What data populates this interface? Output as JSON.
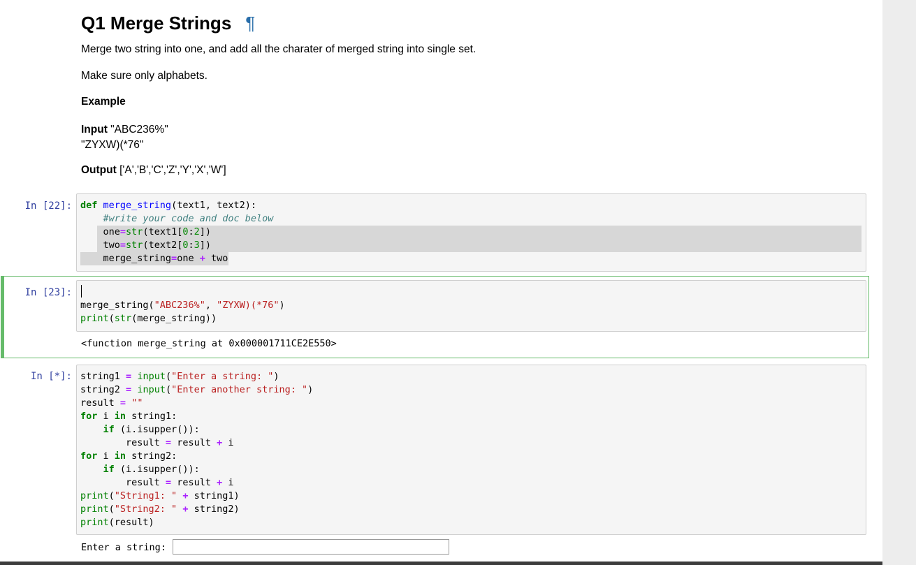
{
  "markdown": {
    "title": "Q1 Merge Strings",
    "pilcrow": "¶",
    "p1": "Merge two string into one, and add all the charater of merged string into single set.",
    "p2": "Make sure only alphabets.",
    "example_heading": "Example",
    "input_label": "Input",
    "input_value_1": " \"ABC236%\"",
    "input_value_2": "\"ZYXW)(*76\"",
    "output_label": "Output",
    "output_value": " ['A','B','C','Z','Y','X','W']"
  },
  "cell1": {
    "prompt": "In  [22]:",
    "lines": [
      [
        "def",
        "def"
      ],
      [
        "fn",
        " merge_string"
      ],
      [
        "plain",
        "(text1, text2):"
      ]
    ]
  },
  "cell2": {
    "prompt": "In  [23]:",
    "output": "<function merge_string at 0x000001711CE2E550>"
  },
  "cell3": {
    "prompt": "In  [*]:",
    "stdin_prompt": "Enter a string:",
    "stdin_value": ""
  },
  "colors": {
    "prompt": "#303f9f",
    "keyword": "#008000",
    "string": "#ba2121",
    "comment": "#408080",
    "operator": "#aa22ff",
    "selected_border": "#66bb6a"
  }
}
